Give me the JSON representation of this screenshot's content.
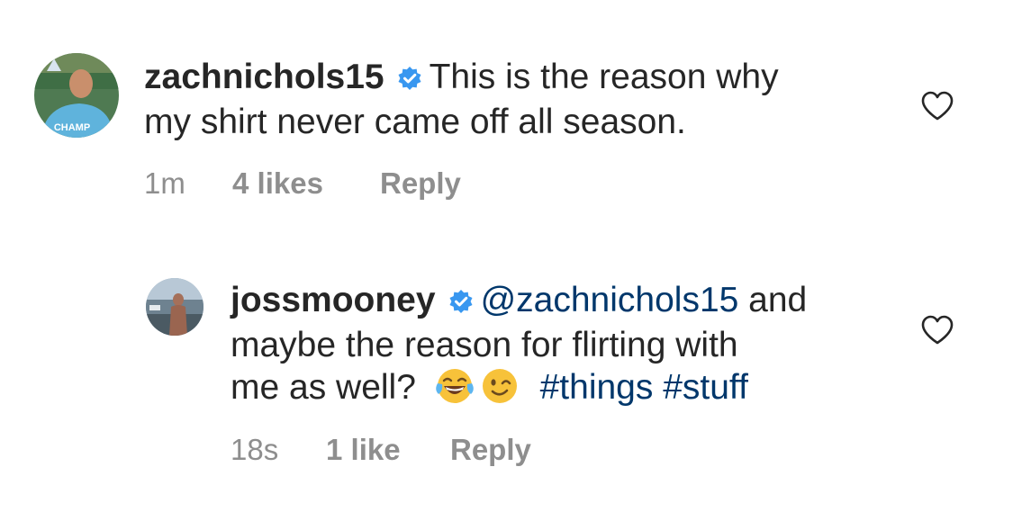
{
  "comments": [
    {
      "username": "zachnichols15",
      "verified": true,
      "text": "This is the reason why my shirt never came off all season.",
      "line1": "This is the reason why",
      "line2": "my shirt never came off all season.",
      "avatar_text": "CHAMP",
      "time": "1m",
      "likes": "4 likes",
      "reply_label": "Reply"
    },
    {
      "username": "jossmooney",
      "verified": true,
      "mention": "@zachnichols15",
      "text_after_mention": "and",
      "line2": "maybe the reason for flirting with",
      "line3_prefix": "me as well?",
      "emojis": [
        "face-with-tears-of-joy",
        "winking-face"
      ],
      "hashtags": [
        "#things",
        "#stuff"
      ],
      "time": "18s",
      "likes": "1 like",
      "reply_label": "Reply"
    }
  ],
  "colors": {
    "text": "#262626",
    "meta": "#8e8e8e",
    "link": "#00376b",
    "verified": "#3897f0"
  },
  "icons": [
    "verified-badge-icon",
    "heart-icon",
    "face-with-tears-of-joy-icon",
    "winking-face-icon"
  ]
}
